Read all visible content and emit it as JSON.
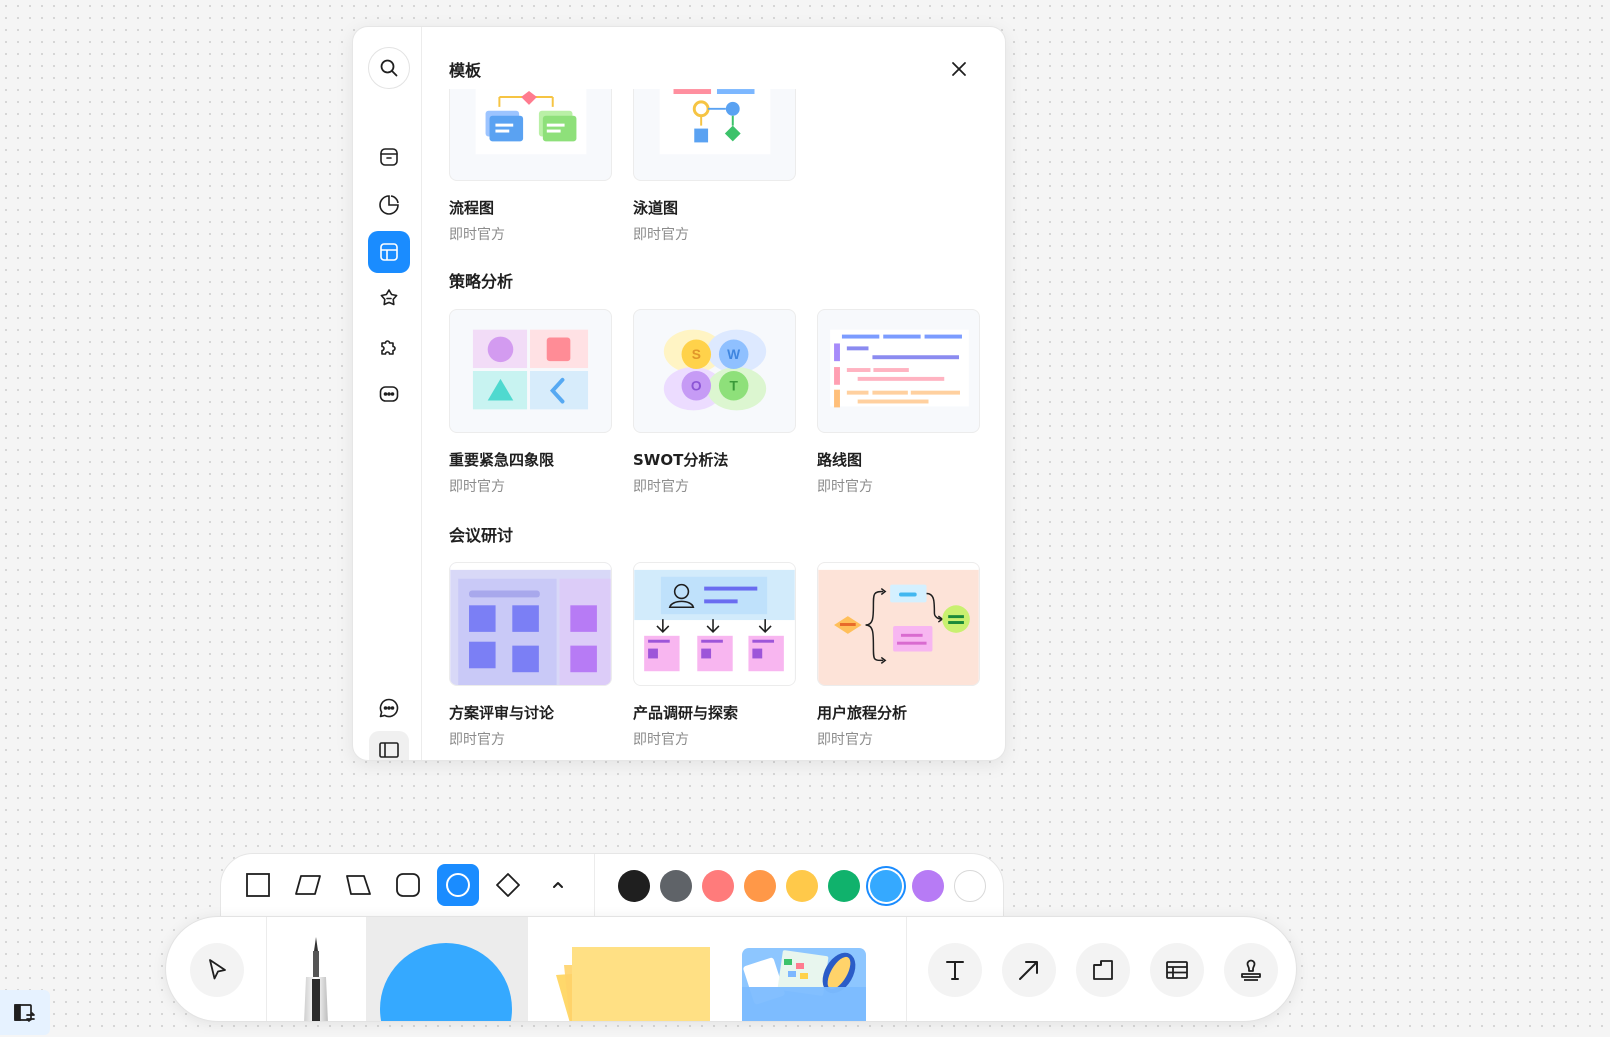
{
  "panel": {
    "title": "模板",
    "sections": [
      {
        "title": "策略分析"
      },
      {
        "title": "会议研讨"
      }
    ],
    "top_cards": [
      {
        "name": "流程图",
        "author": "即时官方"
      },
      {
        "name": "泳道图",
        "author": "即时官方"
      }
    ],
    "strategy_cards": [
      {
        "name": "重要紧急四象限",
        "author": "即时官方"
      },
      {
        "name": "SWOT分析法",
        "author": "即时官方"
      },
      {
        "name": "路线图",
        "author": "即时官方"
      }
    ],
    "meeting_cards": [
      {
        "name": "方案评审与讨论",
        "author": "即时官方"
      },
      {
        "name": "产品调研与探索",
        "author": "即时官方"
      },
      {
        "name": "用户旅程分析",
        "author": "即时官方"
      }
    ],
    "swot_letters": [
      "S",
      "W",
      "O",
      "T"
    ]
  },
  "rail_icons": [
    "search-icon",
    "package-icon",
    "pie-chart-icon",
    "template-icon",
    "sparkle-icon",
    "puzzle-icon",
    "more-icon",
    "comment-icon",
    "sidebar-icon"
  ],
  "shape_tools": [
    "rectangle",
    "parallelogram",
    "trapezoid",
    "rounded-rectangle",
    "circle",
    "diamond"
  ],
  "active_shape": "circle",
  "colors": [
    "#1f1f1f",
    "#5f6368",
    "#ff7b7b",
    "#ff9848",
    "#ffc94a",
    "#10b26c",
    "#35a9ff",
    "#b77bf5",
    "#ffffff"
  ],
  "selected_color": "#35a9ff",
  "main_tools": [
    "select-tool",
    "pen-tool",
    "shape-tool",
    "sticky-note-tool",
    "media-folder-tool",
    "text-tool",
    "arrow-tool",
    "frame-tool",
    "table-tool",
    "stamp-tool"
  ],
  "accent": "#1a8cff"
}
